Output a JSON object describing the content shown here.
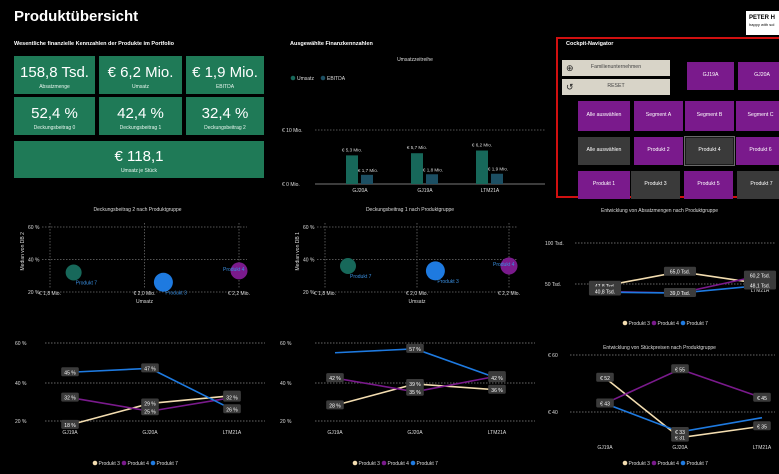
{
  "header": {
    "title": "Produktübersicht",
    "logo_text": "PETER H",
    "logo_subtext": "happy with sol"
  },
  "kpi_section": {
    "title": "Wesentliche finanzielle Kennzahlen der Produkte im Portfolio",
    "tiles": [
      {
        "value": "158,8 Tsd.",
        "label": "Absatzmenge"
      },
      {
        "value": "€ 6,2 Mio.",
        "label": "Umsatz"
      },
      {
        "value": "€ 1,9 Mio.",
        "label": "EBITDA"
      },
      {
        "value": "52,4 %",
        "label": "Deckungsbeitrag 0"
      },
      {
        "value": "42,4 %",
        "label": "Deckungsbeitrag 1"
      },
      {
        "value": "32,4 %",
        "label": "Deckungsbeitrag 2"
      },
      {
        "value": "€ 118,1",
        "label": "Umsatz je Stück"
      }
    ]
  },
  "fin_section": {
    "title": "Ausgewählte Finanzkennzahlen"
  },
  "cockpit": {
    "title": "Cockpit-Navigator",
    "family_label": "Familienunternehmen",
    "reset_label": "RESET",
    "years": [
      "GJ19A",
      "GJ20A"
    ],
    "segment_all": "Alle auswählen",
    "segments": [
      "Segment A",
      "Segment B",
      "Segment C"
    ],
    "product_all": "Alle auswählen",
    "products_row1": [
      "Produkt 2",
      "Produkt 4",
      "Produkt 6"
    ],
    "products_row2": [
      "Produkt 1",
      "Produkt 3",
      "Produkt 5",
      "Produkt 7"
    ]
  },
  "colors": {
    "green": "#1f7a57",
    "teal": "#17685a",
    "purple": "#7a1a8c",
    "blue": "#1e7ae0",
    "beige": "#f3ddb0",
    "red": "#d01010"
  },
  "chart_data": [
    {
      "type": "bar",
      "title": "Umsatzzeitreihe",
      "categories": [
        "GJ20A",
        "GJ19A",
        "LTM21A"
      ],
      "series": [
        {
          "name": "Umsatz",
          "values": [
            5.3,
            5.7,
            6.2
          ],
          "labels": [
            "€ 5,3 Mio.",
            "€ 5,7 Mio.",
            "€ 6,2 Mio."
          ]
        },
        {
          "name": "EBITDA",
          "values": [
            1.7,
            1.8,
            1.9
          ],
          "labels": [
            "€ 1,7 Mio.",
            "€ 1,8 Mio.",
            "€ 1,9 Mio."
          ]
        }
      ],
      "yticks": [
        "€ 10 Mio.",
        "€ 0 Mio."
      ],
      "ylim": [
        0,
        10
      ],
      "legend": "top-left"
    },
    {
      "type": "scatter",
      "title": "Deckungsbeitrag 2 nach Produktgruppe",
      "xlabel": "Umsatz",
      "ylabel": "Median von DB 2",
      "xticks": [
        "€ 1,8 Mio.",
        "€ 2,0 Mio.",
        "€ 2,2 Mio."
      ],
      "yticks": [
        "60 %",
        "40 %",
        "20 %"
      ],
      "points": [
        {
          "name": "Produkt 7",
          "x": 1.85,
          "y": 32
        },
        {
          "name": "Produkt 3",
          "x": 2.04,
          "y": 26
        },
        {
          "name": "Produkt 4",
          "x": 2.2,
          "y": 33
        }
      ]
    },
    {
      "type": "scatter",
      "title": "Deckungsbeitrag 1 nach Produktgruppe",
      "xlabel": "Umsatz",
      "ylabel": "Median von DB 1",
      "xticks": [
        "€ 1,8 Mio.",
        "€ 2,0 Mio.",
        "€ 2,2 Mio."
      ],
      "yticks": [
        "60 %",
        "40 %",
        "20 %"
      ],
      "points": [
        {
          "name": "Produkt 7",
          "x": 1.85,
          "y": 36
        },
        {
          "name": "Produkt 3",
          "x": 2.04,
          "y": 33
        },
        {
          "name": "Produkt 4",
          "x": 2.2,
          "y": 36
        }
      ]
    },
    {
      "type": "line",
      "title": "Entwicklung von Absatzmengen nach Produktgruppe",
      "categories": [
        "GJ19A",
        "GJ20A",
        "LTM21A"
      ],
      "yticks": [
        "100 Tsd.",
        "50 Tsd."
      ],
      "series": [
        {
          "name": "Produkt 3",
          "values": [
            47.8,
            65.0,
            50.5
          ],
          "labels": [
            "47,8 Tsd.",
            "65,0 Tsd.",
            "50,5 Tsd."
          ]
        },
        {
          "name": "Produkt 4",
          "values": [
            40.8,
            39.0,
            60.2
          ],
          "labels": [
            "40,8 Tsd.",
            "39,0 Tsd.",
            "60,2 Tsd."
          ]
        },
        {
          "name": "Produkt 7",
          "values": [
            40,
            39,
            48.1
          ],
          "labels": [
            "",
            "",
            "48,1 Tsd."
          ]
        }
      ],
      "legend": [
        "Produkt 3",
        "Produkt 4",
        "Produkt 7"
      ]
    },
    {
      "type": "line",
      "title": "",
      "categories": [
        "GJ19A",
        "GJ20A",
        "LTM21A"
      ],
      "yticks": [
        "60 %",
        "40 %",
        "20 %"
      ],
      "series": [
        {
          "name": "Produkt 3",
          "values": [
            18,
            29,
            33
          ],
          "labels": [
            "18 %",
            "29 %",
            "33 %"
          ]
        },
        {
          "name": "Produkt 4",
          "values": [
            32,
            25,
            32
          ],
          "labels": [
            "32 %",
            "25 %",
            "32 %"
          ]
        },
        {
          "name": "Produkt 7",
          "values": [
            45,
            47,
            26
          ],
          "labels": [
            "45 %",
            "47 %",
            "26 %"
          ]
        }
      ],
      "legend": [
        "Produkt 3",
        "Produkt 4",
        "Produkt 7"
      ]
    },
    {
      "type": "line",
      "title": "",
      "categories": [
        "GJ19A",
        "GJ20A",
        "LTM21A"
      ],
      "yticks": [
        "60 %",
        "40 %",
        "20 %"
      ],
      "series": [
        {
          "name": "Produkt 3",
          "values": [
            28,
            39,
            36
          ],
          "labels": [
            "28 %",
            "39 %",
            "36 %"
          ]
        },
        {
          "name": "Produkt 4",
          "values": [
            42,
            35,
            43
          ],
          "labels": [
            "42 %",
            "35 %",
            "43 %"
          ]
        },
        {
          "name": "Produkt 7",
          "values": [
            55,
            57,
            42
          ],
          "labels": [
            "",
            "57 %",
            "42 %"
          ]
        }
      ],
      "legend": [
        "Produkt 3",
        "Produkt 4",
        "Produkt 7"
      ]
    },
    {
      "type": "line",
      "title": "Entwicklung von Stückpreisen nach Produktgruppe",
      "categories": [
        "GJ19A",
        "GJ20A",
        "LTM21A"
      ],
      "yticks": [
        "€ 60",
        "€ 40"
      ],
      "series": [
        {
          "name": "Produkt 3",
          "values": [
            52,
            31,
            35
          ],
          "labels": [
            "€ 52",
            "€ 31",
            "€ 35"
          ]
        },
        {
          "name": "Produkt 4",
          "values": [
            43,
            55,
            45
          ],
          "labels": [
            "€ 43",
            "€ 55",
            "€ 45"
          ]
        },
        {
          "name": "Produkt 7",
          "values": [
            43,
            33,
            38
          ],
          "labels": [
            "",
            "€ 33",
            ""
          ]
        }
      ],
      "legend": [
        "Produkt 3",
        "Produkt 4",
        "Produkt 7"
      ]
    }
  ]
}
